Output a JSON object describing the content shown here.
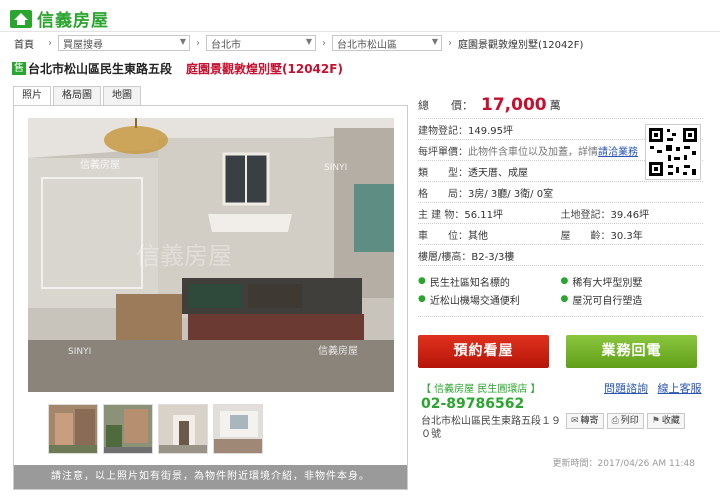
{
  "brand": {
    "name": "信義房屋",
    "color": "#2aa52d"
  },
  "breadcrumb": {
    "home": "首頁",
    "selects": [
      "買屋搜尋",
      "台北市",
      "台北市松山區"
    ],
    "current": "庭園景觀敦煌別墅(12042F)"
  },
  "listing": {
    "tag": "售",
    "address": "台北市松山區民生東路五段",
    "name": "庭園景觀敦煌別墅(12042F)"
  },
  "tabs": [
    "照片",
    "格局圖",
    "地圖"
  ],
  "gallery": {
    "watermark": "信義房屋",
    "watermark_en": "SINYI",
    "notice": "請注意，以上照片如有街景，為物件附近環境介紹，非物件本身。"
  },
  "info": {
    "price_label": "總　　價：",
    "price": "17,000",
    "price_unit": "萬",
    "building_label": "建物登記：",
    "building": "149.95坪",
    "unit_price_label": "每坪單價：",
    "unit_price_note": "此物件含車位以及加蓋，詳情",
    "unit_price_link": "請洽業務",
    "type_label": "類　　型：",
    "type": "透天厝、成屋",
    "layout_label": "格　　局：",
    "layout": "3房/ 3廳/ 3衛/ 0室",
    "main_label": "主 建 物：",
    "main": "56.11坪",
    "land_label": "土地登記：",
    "land": "39.46坪",
    "parking_label": "車　　位：",
    "parking": "其他",
    "age_label": "屋　　齡：",
    "age": "30.3年",
    "floor_label": "樓層/樓高：",
    "floor": "B2-3/3樓"
  },
  "features": [
    "民生社區知名標的",
    "稀有大坪型別墅",
    "近松山機場交通便利",
    "屋況可自行塑造"
  ],
  "actions": {
    "book": "預約看屋",
    "callback": "業務回電"
  },
  "store": {
    "name": "【 信義房屋 民生圓環店 】",
    "phone": "02-89786562",
    "address": "台北市松山區民生東路五段１９０號"
  },
  "links": {
    "faq": "問題諮詢",
    "service": "線上客服"
  },
  "tools": {
    "forward": "轉寄",
    "print": "列印",
    "favorite": "收藏"
  },
  "updated": "更新時間：2017/04/26 AM 11:48"
}
